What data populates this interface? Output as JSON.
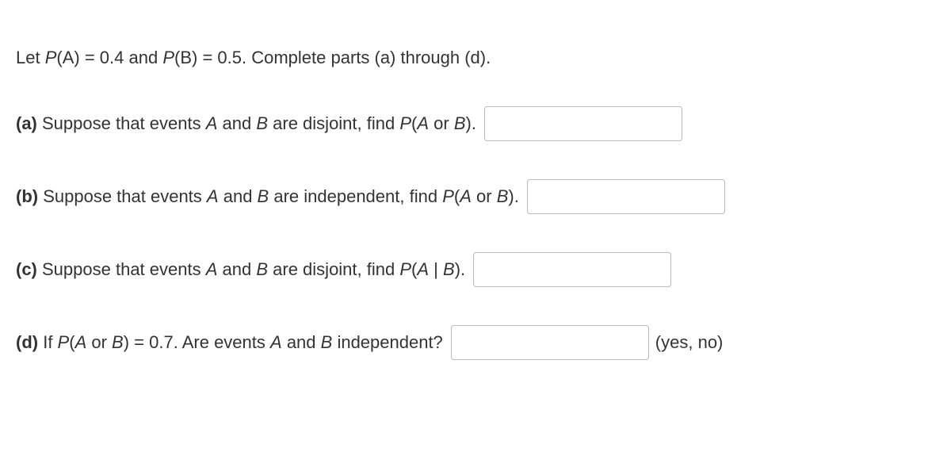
{
  "intro": {
    "prefix": "Let ",
    "pa_var": "P",
    "pa_arg": "(A)",
    "pa_eq": " = 0.4 and ",
    "pb_var": "P",
    "pb_arg": "(B)",
    "pb_eq": " = 0.5. Complete parts (a) through (d)."
  },
  "a": {
    "label": "(a)",
    "t1": " Suppose that events ",
    "A": "A",
    "t2": " and ",
    "B": "B",
    "t3": " are disjoint, find ",
    "P": "P",
    "args": "(A",
    "or": " or ",
    "args2": "B)",
    "end": "."
  },
  "b": {
    "label": "(b)",
    "t1": " Suppose that events ",
    "A": "A",
    "t2": " and ",
    "B": "B",
    "t3": " are independent, find ",
    "P": "P",
    "args": "(A",
    "or": " or ",
    "args2": "B)",
    "end": "."
  },
  "c": {
    "label": "(c)",
    "t1": " Suppose that events ",
    "A": "A",
    "t2": " and ",
    "B": "B",
    "t3": " are disjoint, find ",
    "P": "P",
    "args": "(A | B)",
    "end": "."
  },
  "d": {
    "label": "(d)",
    "t1": " If ",
    "P": "P",
    "args": "(A",
    "or": " or ",
    "args2": "B)",
    "eq": " = 0.7. Are events ",
    "A": "A",
    "t2": " and ",
    "B": "B",
    "t3": " independent?",
    "suffix": "(yes, no)"
  }
}
